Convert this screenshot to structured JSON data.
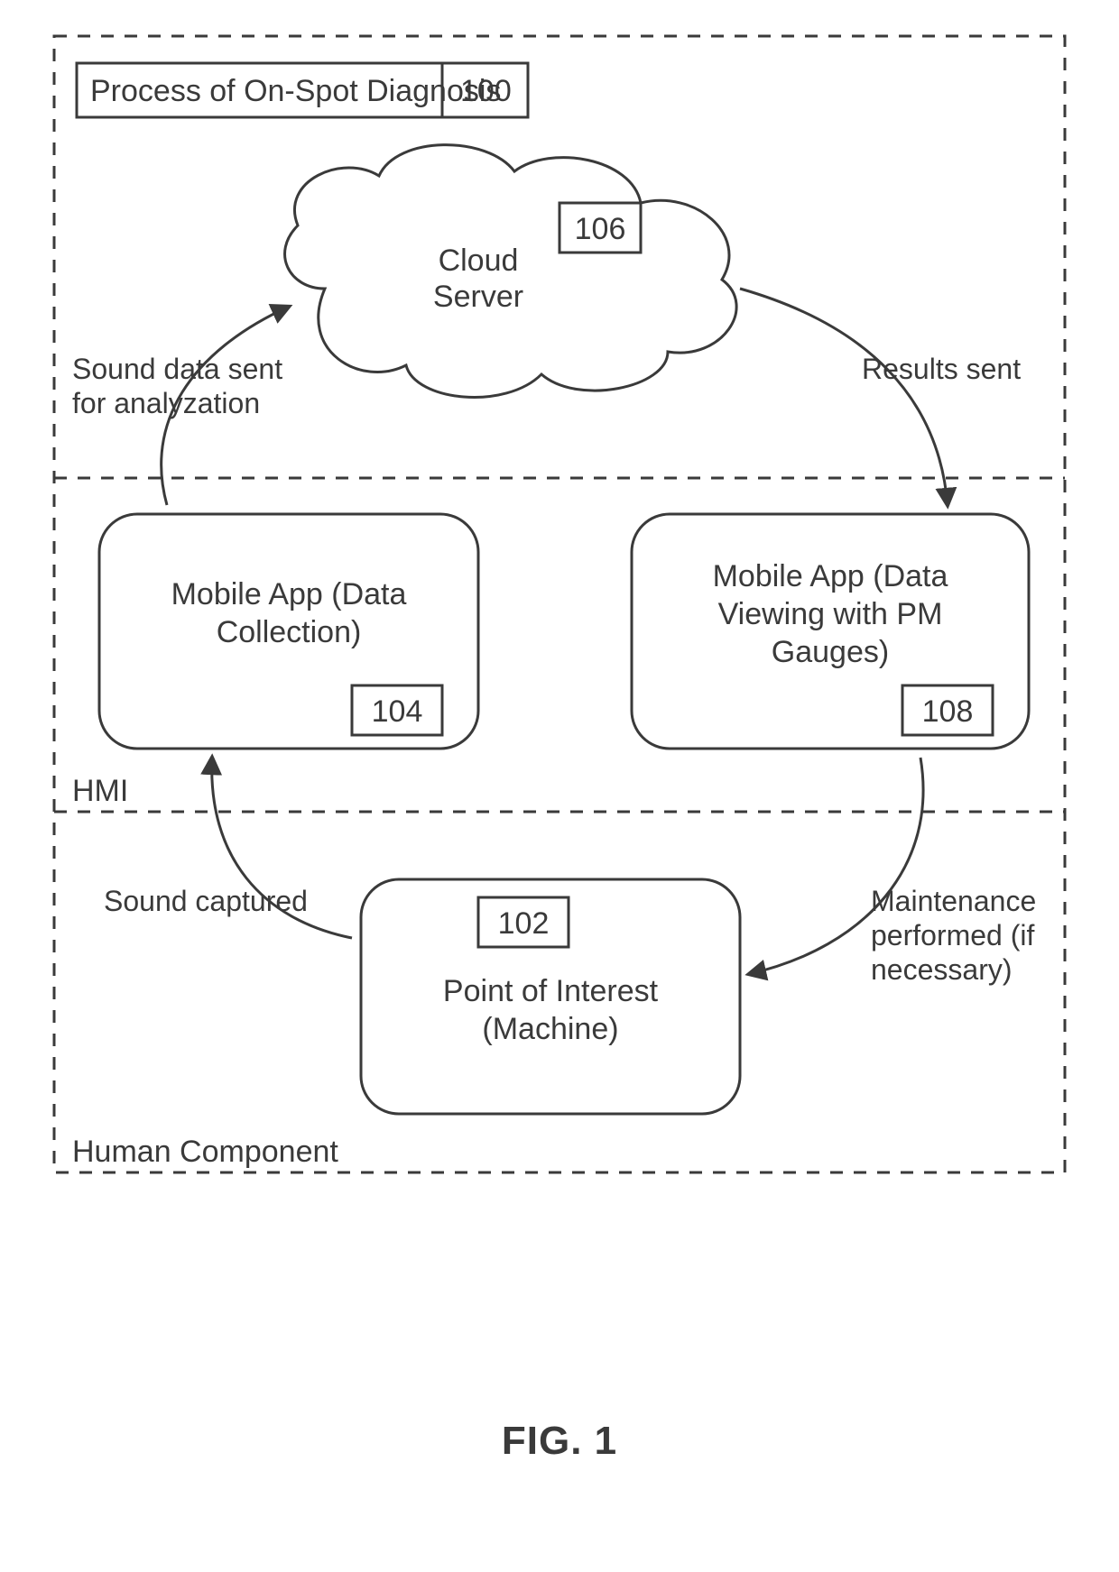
{
  "figure_caption": "FIG. 1",
  "title_box": {
    "label": "Process of On-Spot Diagnosis",
    "ref": "100"
  },
  "regions": {
    "top": {
      "label": ""
    },
    "middle": {
      "label": "HMI"
    },
    "bottom": {
      "label": "Human Component"
    }
  },
  "nodes": {
    "cloud": {
      "label_line1": "Cloud",
      "label_line2": "Server",
      "ref": "106"
    },
    "app_collect": {
      "label_line1": "Mobile App (Data",
      "label_line2": "Collection)",
      "ref": "104"
    },
    "app_view": {
      "label_line1": "Mobile App (Data",
      "label_line2": "Viewing with PM",
      "label_line3": "Gauges)",
      "ref": "108"
    },
    "poi": {
      "label_line1": "Point of Interest",
      "label_line2": "(Machine)",
      "ref": "102"
    }
  },
  "edges": {
    "sound_sent": {
      "line1": "Sound data sent",
      "line2": "for analyzation"
    },
    "results_sent": {
      "line1": "Results sent"
    },
    "sound_captured": {
      "line1": "Sound captured"
    },
    "maintenance": {
      "line1": "Maintenance",
      "line2": "performed (if",
      "line3": "necessary)"
    }
  }
}
